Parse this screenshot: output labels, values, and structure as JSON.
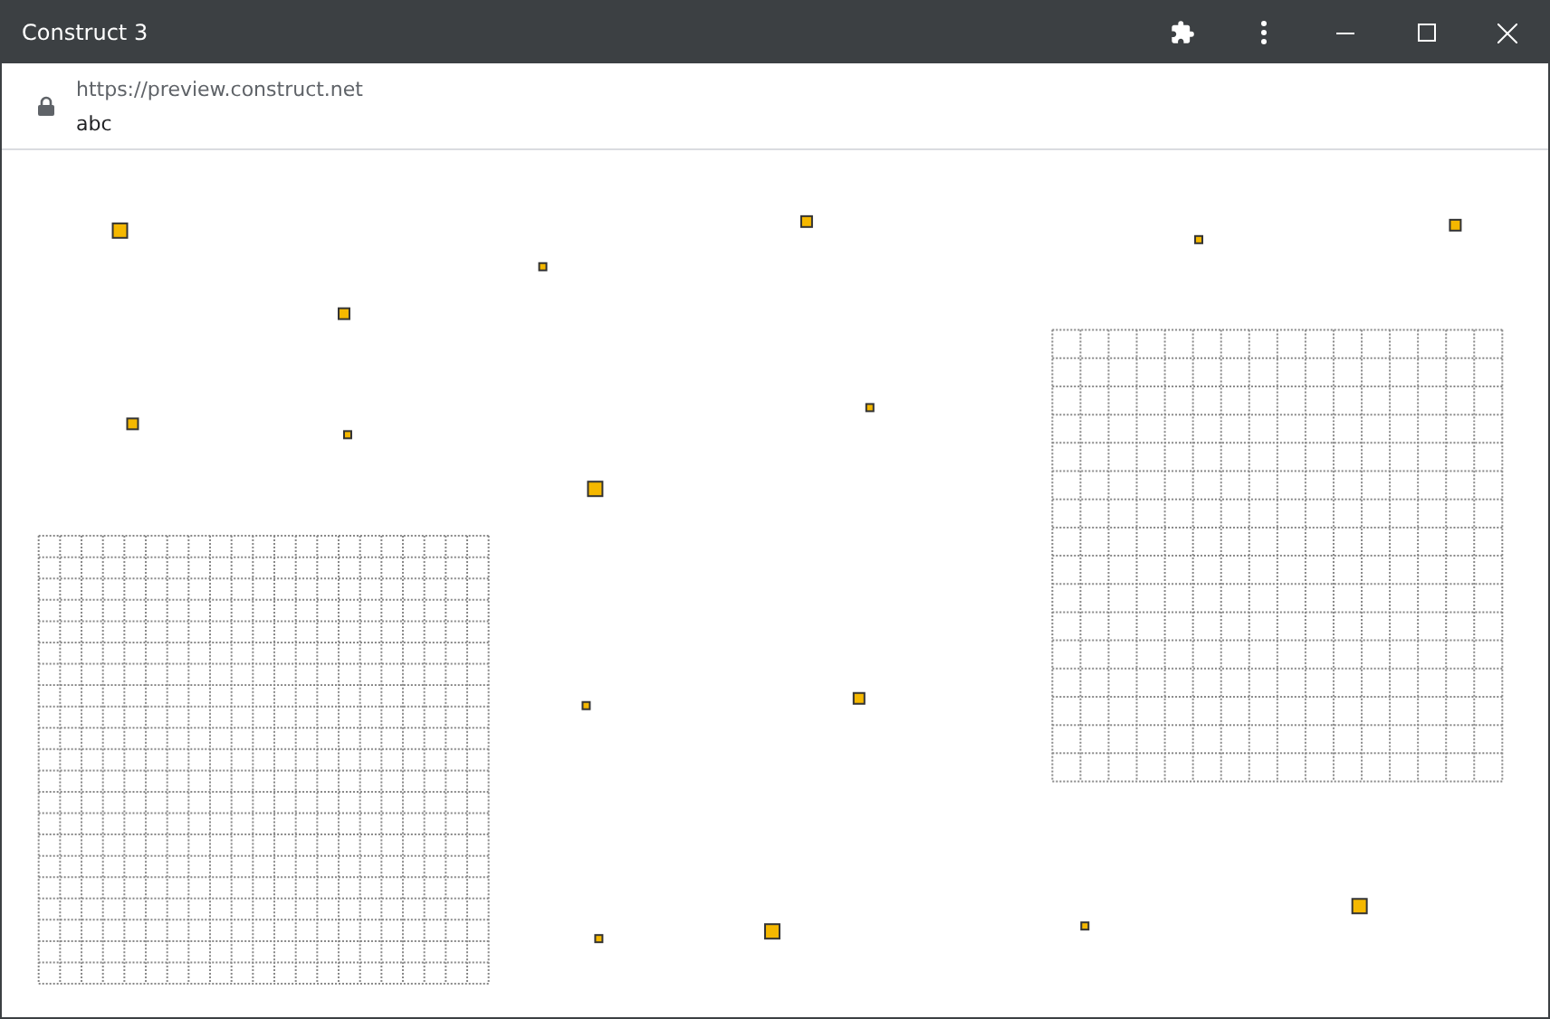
{
  "window": {
    "title": "Construct 3"
  },
  "address_bar": {
    "url": "https://preview.construct.net",
    "page_title": "abc"
  }
}
